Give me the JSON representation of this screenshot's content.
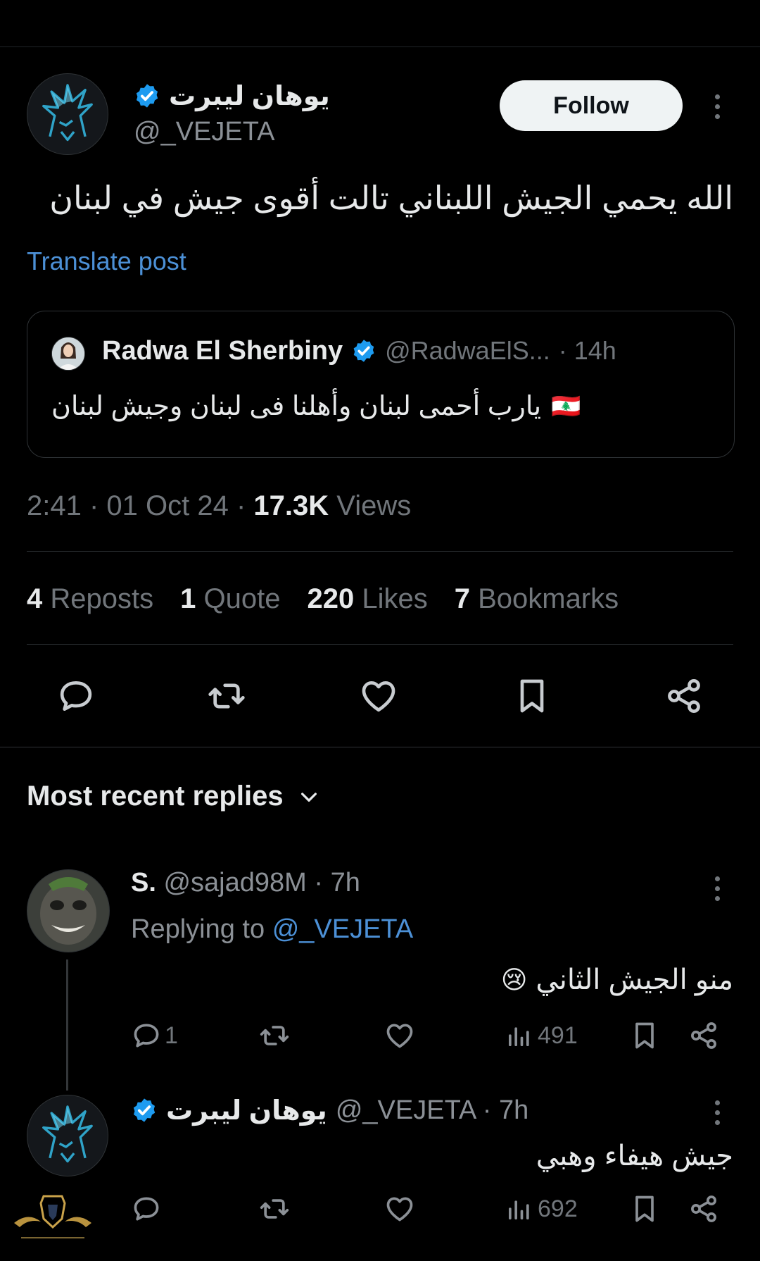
{
  "post": {
    "author_name": "يوهان ليبرت",
    "author_handle": "@_VEJETA",
    "follow_label": "Follow",
    "text": "الله يحمي الجيش اللبناني تالت أقوى جيش في لبنان",
    "translate_label": "Translate post",
    "quoted": {
      "name": "Radwa El Sherbiny",
      "handle": "@RadwaElS...",
      "time": "· 14h",
      "text": "يارب أحمى لبنان وأهلنا فى لبنان وجيش لبنان",
      "flag": "🇱🇧"
    },
    "time": "2:41 · 01 Oct 24 ·",
    "views_count": "17.3K",
    "views_label": "Views",
    "stats": {
      "reposts_count": "4",
      "reposts_label": "Reposts",
      "quote_count": "1",
      "quote_label": "Quote",
      "likes_count": "220",
      "likes_label": "Likes",
      "bookmarks_count": "7",
      "bookmarks_label": "Bookmarks"
    }
  },
  "replies_header": {
    "label": "Most recent replies"
  },
  "replies": [
    {
      "name": "S.",
      "handle": "@sajad98M · 7h",
      "replying_prefix": "Replying to",
      "replying_to": "@_VEJETA",
      "text": "منو الجيش الثاني",
      "emoji": "😢",
      "reply_count": "1",
      "views": "491"
    },
    {
      "name": "يوهان ليبرت",
      "handle": "@_VEJETA · 7h",
      "text": "جيش هيفاء وهبي",
      "views": "692"
    }
  ],
  "colors": {
    "accent": "#1d9bf0",
    "muted": "#71767b",
    "link": "#4c90d6",
    "background": "#000000"
  },
  "icons": [
    "verified-icon",
    "more-icon",
    "reply-icon",
    "repost-icon",
    "like-icon",
    "bookmark-icon",
    "share-icon",
    "views-icon",
    "chevron-down-icon"
  ]
}
